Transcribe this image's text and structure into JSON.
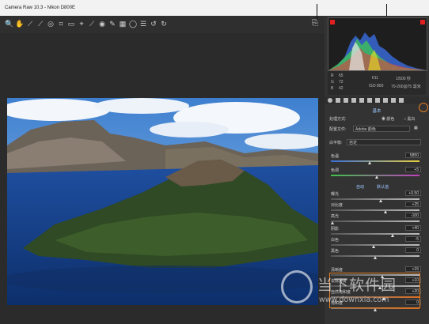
{
  "window": {
    "title": "Camera Raw 10.3 - Nikon D800E"
  },
  "toolbar": {
    "tools": [
      "zoom",
      "hand",
      "white-balance",
      "color-sampler",
      "target-adjust",
      "crop",
      "straighten",
      "transform",
      "spot-removal",
      "redeye",
      "adjustment-brush",
      "graduated-filter",
      "radial-filter",
      "preferences",
      "rotate-left",
      "rotate-right"
    ],
    "icons": [
      "🔍",
      "✋",
      "⟋",
      "⟋",
      "◎",
      "⌗",
      "▭",
      "⌖",
      "⟋",
      "◉",
      "✎",
      "▦",
      "◯",
      "☰",
      "↺",
      "↻"
    ]
  },
  "info": {
    "r_label": "R",
    "r_val": "65",
    "g_label": "G",
    "g_val": "72",
    "b_label": "B",
    "b_val": "42",
    "aperture": "f/11",
    "shutter": "1/500 秒",
    "iso": "ISO 800",
    "lens": "70-200@75 毫米"
  },
  "panel": {
    "title": "基本",
    "treatment_label": "处理方式:",
    "treatment_color": "颜色",
    "treatment_bw": "黑白",
    "profile_label": "配置文件:",
    "profile_value": "Adobe 颜色",
    "wb_label": "白平衡:",
    "wb_value": "自定",
    "auto": "自动",
    "default": "默认值",
    "sliders": [
      {
        "label": "色温",
        "value": "5850",
        "pos": 0.44
      },
      {
        "label": "色调",
        "value": "+5",
        "pos": 0.52
      },
      {
        "label": "曝光",
        "value": "+0.50",
        "pos": 0.56
      },
      {
        "label": "对比度",
        "value": "+25",
        "pos": 0.62
      },
      {
        "label": "高光",
        "value": "-100",
        "pos": 0.02
      },
      {
        "label": "阴影",
        "value": "+40",
        "pos": 0.7
      },
      {
        "label": "白色",
        "value": "-5",
        "pos": 0.48
      },
      {
        "label": "黑色",
        "value": "0",
        "pos": 0.5
      },
      {
        "label": "清晰度",
        "value": "+15",
        "pos": 0.58
      },
      {
        "label": "去除薄雾",
        "value": "+10",
        "pos": 0.55
      },
      {
        "label": "自然饱和度",
        "value": "+20",
        "pos": 0.6
      },
      {
        "label": "饱和度",
        "value": "0",
        "pos": 0.5
      }
    ]
  },
  "watermark": {
    "text": "当下软件园",
    "url": "www.downxia.com"
  }
}
